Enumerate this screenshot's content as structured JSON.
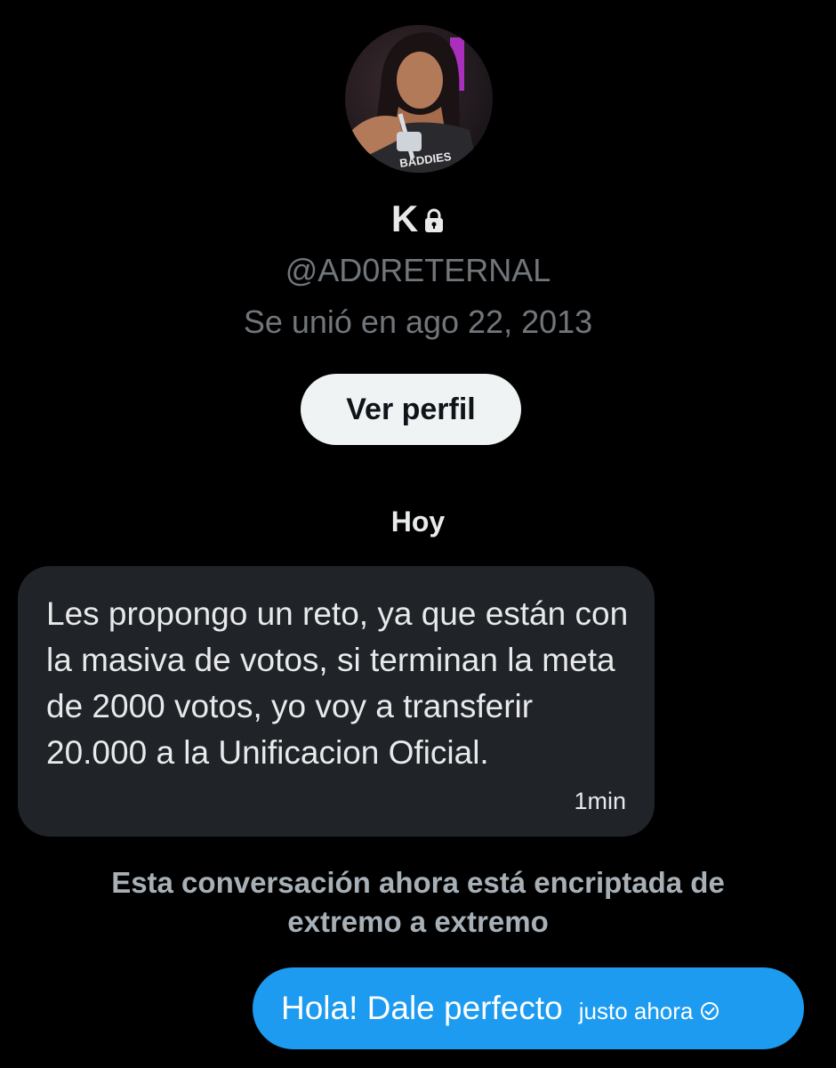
{
  "profile": {
    "name": "K",
    "handle": "@AD0RETERNAL",
    "joined": "Se unió en ago 22, 2013",
    "view_profile_label": "Ver perfil",
    "avatar_shirt_text": "BADDIES",
    "icons": {
      "lock": "lock-icon"
    }
  },
  "chat": {
    "day_label": "Hoy",
    "incoming": {
      "text": "Les propongo un reto, ya que están con la masiva de votos, si terminan la meta de 2000 votos, yo voy a transferir 20.000 a la Unificacion Oficial.",
      "time": "1min"
    },
    "encryption_notice": "Esta conversación ahora está encriptada de extremo a extremo",
    "outgoing": {
      "text": "Hola! Dale perfecto",
      "time": "justo ahora",
      "status_icon": "check-circle-icon"
    }
  },
  "colors": {
    "background": "#000000",
    "incoming_bubble": "#202327",
    "outgoing_bubble": "#1d9bf0",
    "muted_text": "#71767b",
    "button_bg": "#eff3f4"
  }
}
